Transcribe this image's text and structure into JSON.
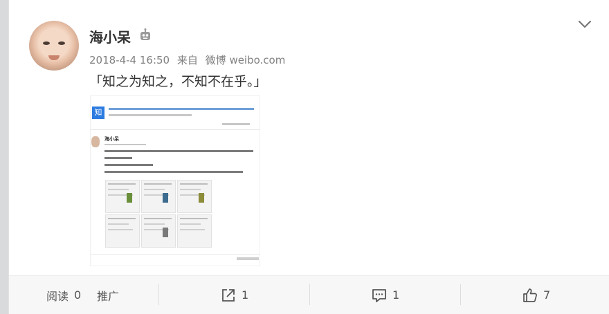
{
  "post": {
    "username": "海小呆",
    "user_badge_icon": "robot-icon",
    "timestamp": "2018-4-4 16:50",
    "source_prefix": "来自",
    "source_name": "微博 weibo.com",
    "text": "「知之为知之，不知不在乎。」",
    "more_icon": "chevron-down-icon"
  },
  "embedded_image": {
    "icon_char": "知",
    "inner_username": "海小呆"
  },
  "actions": {
    "read_label": "阅读",
    "read_count": "0",
    "promote_label": "推广",
    "repost_count": "1",
    "comment_count": "1",
    "like_count": "7"
  }
}
